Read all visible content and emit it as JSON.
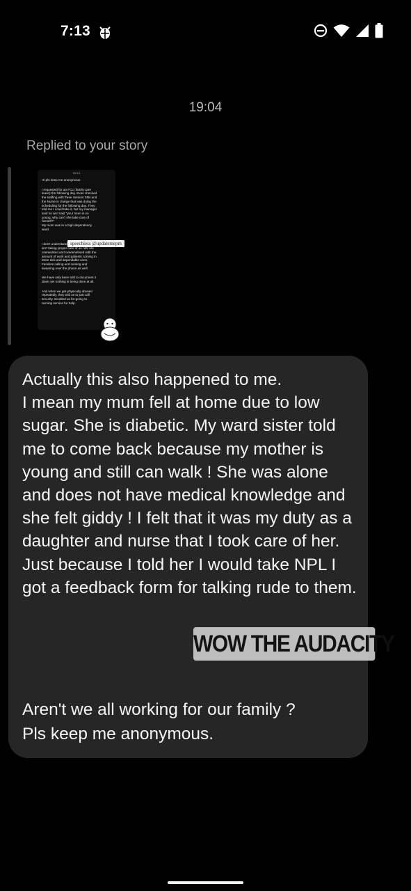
{
  "status_bar": {
    "time": "7:13",
    "icons": [
      "bug-icon",
      "do-not-disturb-icon",
      "wifi-icon",
      "signal-icon",
      "battery-icon"
    ]
  },
  "chat": {
    "timestamp": "19:04",
    "replied_label": "Replied to your story",
    "story": {
      "title": "09:13",
      "lines": [
        "Hi pls keep me anonymous",
        "",
        "I requested for an FCL( family care",
        "leave) the following day. Even checked",
        "the staffing with three Seniors SNs and",
        "the Nurse in charge that was doing the",
        "scheduling for the following day. They",
        "told me I could take it, but my manager",
        "said no and said \"your mom is so",
        "young, why can't she take care of",
        "herself?\"",
        "My mom was in a high dependency",
        "ward.",
        "",
        "",
        "I don't understand why management",
        "isn't taking proper care of us. We are",
        "overworked and overwhelmed with the",
        "amount of work and patients coming in.",
        "More sick and dependable ones.",
        "Families calling and cursing and",
        "swearing over the phone as well.",
        "",
        "We have only been told to document it",
        "down yet nothing is being done at all.",
        "",
        "And when we get physically abused",
        "repeatedly, they told us to just call",
        "security. Scolded us for going to",
        "nursing service for help."
      ],
      "sticker": "speechless @updatemepm"
    },
    "message": {
      "paragraph1": "Actually this also happened to me.\nI mean my mum fell at home due to low sugar. She is diabetic. My ward sister told me to come back because my mother is young and still can walk ! She was alone and does not have medical knowledge and she felt giddy ! I felt that it was my duty as a daughter and nurse that I took care of her. Just because I told her I would take NPL I got a feedback form for talking rude to them.",
      "paragraph2": "Aren't we all working for our family ?\nPls keep me anonymous."
    },
    "overlay_sticker": "WOW THE AUDACITY"
  },
  "colors": {
    "background": "#000000",
    "bubble": "#262626",
    "muted_text": "#a8a8a8"
  }
}
